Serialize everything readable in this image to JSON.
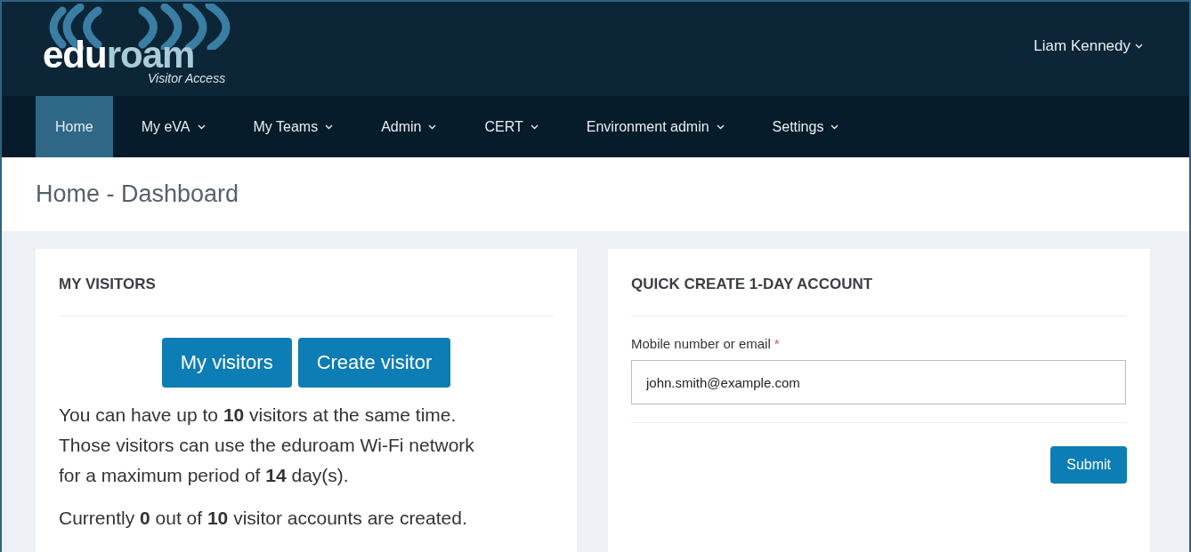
{
  "logo": {
    "wordmark_light": "edu",
    "wordmark_accent": "roam",
    "tagline": "Visitor Access"
  },
  "user_menu": {
    "label": "Liam Kennedy",
    "has_dropdown": true
  },
  "nav": [
    {
      "label": "Home",
      "selected": true,
      "has_dropdown": false
    },
    {
      "label": "My eVA",
      "selected": false,
      "has_dropdown": true
    },
    {
      "label": "My Teams",
      "selected": false,
      "has_dropdown": true
    },
    {
      "label": "Admin",
      "selected": false,
      "has_dropdown": true
    },
    {
      "label": "CERT",
      "selected": false,
      "has_dropdown": true
    },
    {
      "label": "Environment admin",
      "selected": false,
      "has_dropdown": true
    },
    {
      "label": "Settings",
      "selected": false,
      "has_dropdown": true
    }
  ],
  "page_title": "Home - Dashboard",
  "visitors_card": {
    "title": "MY VISITORS",
    "buttons": [
      "My visitors",
      "Create visitor"
    ],
    "paragraphs": [
      "You can have up to **10** visitors at the same time. Those visitors can use the eduroam Wi-Fi network for a maximum period of **14** day(s).",
      "Currently **0** out of **10** visitor accounts are created."
    ]
  },
  "quick_create_card": {
    "title": "QUICK CREATE 1-DAY ACCOUNT",
    "field": {
      "label": "Mobile number or email",
      "required": true,
      "required_mark": "*",
      "value": "john.smith@example.com"
    },
    "submit": "Submit"
  }
}
